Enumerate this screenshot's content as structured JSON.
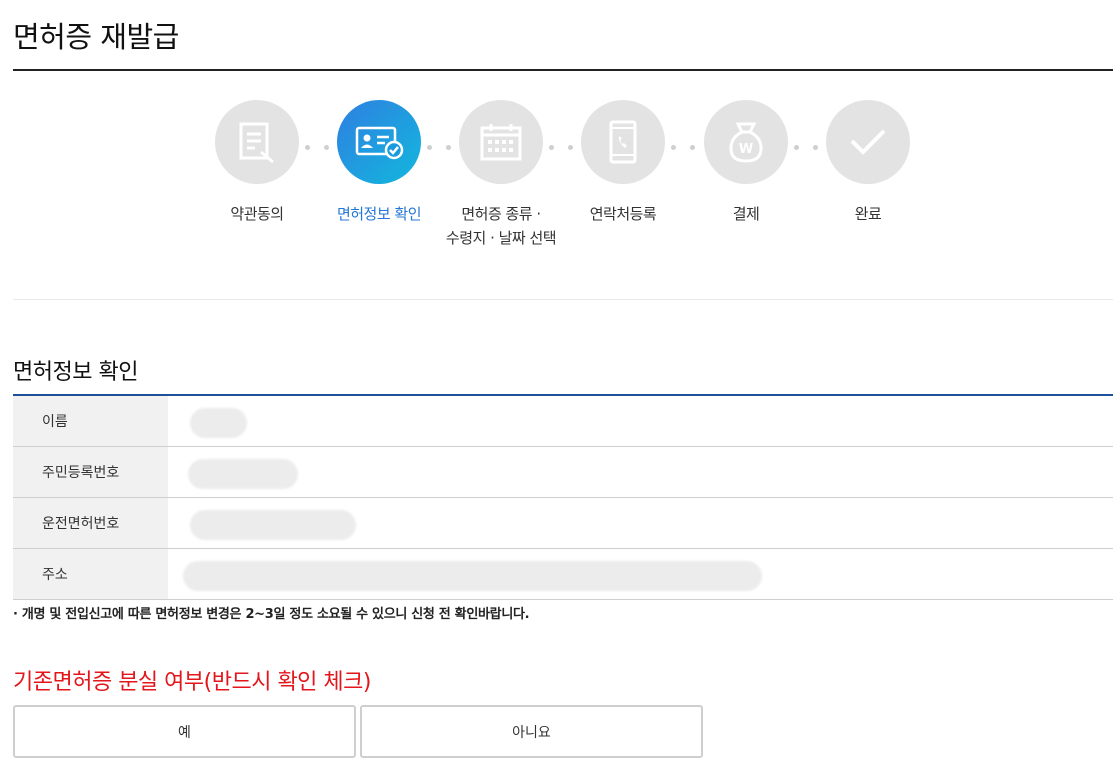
{
  "page": {
    "title": "면허증 재발급"
  },
  "steps": [
    {
      "label_line1": "약관동의",
      "label_line2": "",
      "icon": "document-icon",
      "active": false
    },
    {
      "label_line1": "면허정보 확인",
      "label_line2": "",
      "icon": "id-card-check-icon",
      "active": true
    },
    {
      "label_line1": "면허증 종류 ·",
      "label_line2": "수령지 · 날짜 선택",
      "icon": "calendar-icon",
      "active": false
    },
    {
      "label_line1": "연락처등록",
      "label_line2": "",
      "icon": "phone-icon",
      "active": false
    },
    {
      "label_line1": "결제",
      "label_line2": "",
      "icon": "money-bag-icon",
      "active": false
    },
    {
      "label_line1": "완료",
      "label_line2": "",
      "icon": "check-icon",
      "active": false
    }
  ],
  "info": {
    "title": "면허정보 확인",
    "rows": [
      {
        "label": "이름"
      },
      {
        "label": "주민등록번호"
      },
      {
        "label": "운전면허번호"
      },
      {
        "label": "주소"
      }
    ],
    "notice": "· 개명 및 전입신고에 따른 면허정보 변경은 2~3일 정도 소요될 수 있으니 신청 전 확인바랍니다."
  },
  "loss_check": {
    "title": "기존면허증 분실 여부(반드시 확인 체크)",
    "yes_label": "예",
    "no_label": "아니요"
  },
  "colors": {
    "accent_blue": "#2677d6",
    "table_border": "#1d4f9a",
    "alert_red": "#e3161c",
    "step_inactive": "#e3e3e3"
  }
}
